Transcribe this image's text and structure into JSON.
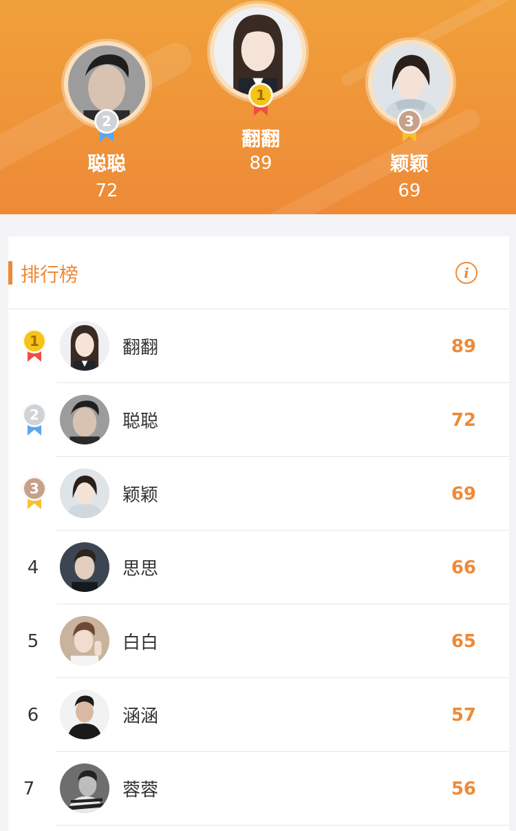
{
  "podium": {
    "first": {
      "name": "翻翻",
      "score": "89",
      "medal": "1"
    },
    "second": {
      "name": "聪聪",
      "score": "72",
      "medal": "2"
    },
    "third": {
      "name": "颖颖",
      "score": "69",
      "medal": "3"
    }
  },
  "leaderboard": {
    "title": "排行榜",
    "info_icon": "info-icon",
    "rows": [
      {
        "rank": "1",
        "name": "翻翻",
        "score": "89"
      },
      {
        "rank": "2",
        "name": "聪聪",
        "score": "72"
      },
      {
        "rank": "3",
        "name": "颖颖",
        "score": "69"
      },
      {
        "rank": "4",
        "name": "思思",
        "score": "66"
      },
      {
        "rank": "5",
        "name": "白白",
        "score": "65"
      },
      {
        "rank": "6",
        "name": "涵涵",
        "score": "57"
      },
      {
        "rank": "7",
        "name": "蓉蓉",
        "score": "56"
      }
    ]
  },
  "colors": {
    "accent": "#ee8a37",
    "header_top": "#f0a03a",
    "gold": "#f5c419",
    "silver": "#cfd2d6",
    "bronze": "#c6a08a"
  }
}
